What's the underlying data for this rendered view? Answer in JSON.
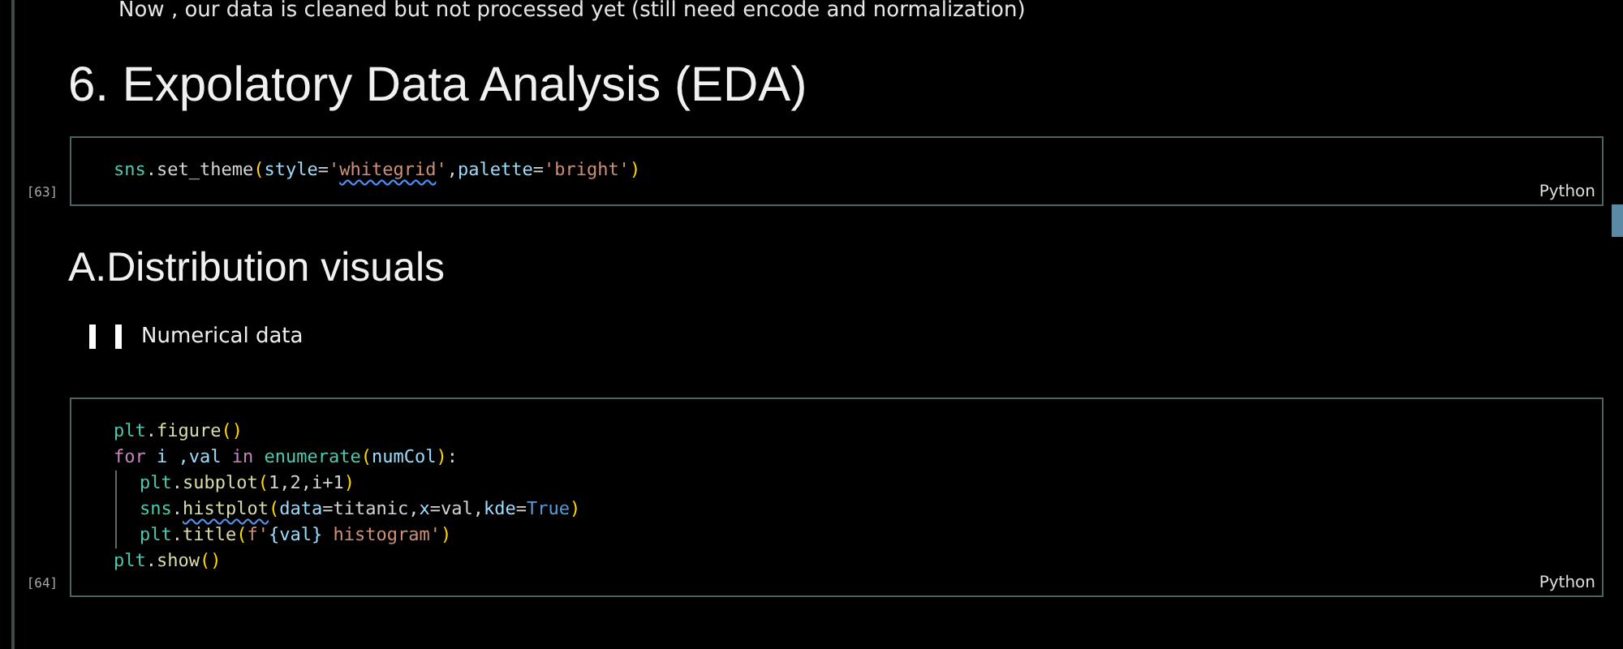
{
  "intro_text": "Now , our data is cleaned but not processed yet (still need encode and normalization)",
  "heading": "6. Expolatory Data Analysis (EDA)",
  "cells": [
    {
      "execution_count": "[63]",
      "language": "Python",
      "lines": [
        {
          "tokens": [
            {
              "t": "sns",
              "kind": "module"
            },
            {
              "t": ".set_theme",
              "kind": "plain"
            },
            {
              "t": "(",
              "kind": "paren"
            },
            {
              "t": "style",
              "kind": "var"
            },
            {
              "t": "=",
              "kind": "plain"
            },
            {
              "t": "'",
              "kind": "str"
            },
            {
              "t": "whitegrid",
              "kind": "str",
              "squiggle": true
            },
            {
              "t": "'",
              "kind": "str"
            },
            {
              "t": ",",
              "kind": "plain"
            },
            {
              "t": "palette",
              "kind": "var"
            },
            {
              "t": "=",
              "kind": "plain"
            },
            {
              "t": "'bright'",
              "kind": "str"
            },
            {
              "t": ")",
              "kind": "paren"
            }
          ]
        }
      ]
    }
  ],
  "subheading": "A.Distribution visuals",
  "quote_text": "Numerical data",
  "cells2": [
    {
      "execution_count": "[64]",
      "language": "Python",
      "lines": [
        {
          "tokens": [
            {
              "t": "plt",
              "kind": "module"
            },
            {
              "t": ".",
              "kind": "plain"
            },
            {
              "t": "figure",
              "kind": "func"
            },
            {
              "t": "()",
              "kind": "paren"
            }
          ]
        },
        {
          "tokens": [
            {
              "t": "for",
              "kind": "kw"
            },
            {
              "t": " i ,",
              "kind": "var"
            },
            {
              "t": "val",
              "kind": "var"
            },
            {
              "t": " in ",
              "kind": "kw"
            },
            {
              "t": "enumerate",
              "kind": "module"
            },
            {
              "t": "(",
              "kind": "paren"
            },
            {
              "t": "numCol",
              "kind": "var"
            },
            {
              "t": ")",
              "kind": "paren"
            },
            {
              "t": ":",
              "kind": "plain"
            }
          ],
          "children": [
            {
              "tokens": [
                {
                  "t": "plt",
                  "kind": "module"
                },
                {
                  "t": ".",
                  "kind": "plain"
                },
                {
                  "t": "subplot",
                  "kind": "func"
                },
                {
                  "t": "(",
                  "kind": "paren"
                },
                {
                  "t": "1,2,i+1",
                  "kind": "plain"
                },
                {
                  "t": ")",
                  "kind": "paren"
                }
              ]
            },
            {
              "tokens": [
                {
                  "t": "sns",
                  "kind": "module"
                },
                {
                  "t": ".",
                  "kind": "plain"
                },
                {
                  "t": "histplot",
                  "kind": "func",
                  "squiggle": true
                },
                {
                  "t": "(",
                  "kind": "paren"
                },
                {
                  "t": "data",
                  "kind": "var"
                },
                {
                  "t": "=titanic,",
                  "kind": "plain"
                },
                {
                  "t": "x",
                  "kind": "var"
                },
                {
                  "t": "=val,",
                  "kind": "plain"
                },
                {
                  "t": "kde",
                  "kind": "var"
                },
                {
                  "t": "=",
                  "kind": "plain"
                },
                {
                  "t": "True",
                  "kind": "const"
                },
                {
                  "t": ")",
                  "kind": "paren"
                }
              ]
            },
            {
              "tokens": [
                {
                  "t": "plt",
                  "kind": "module"
                },
                {
                  "t": ".",
                  "kind": "plain"
                },
                {
                  "t": "title",
                  "kind": "func"
                },
                {
                  "t": "(",
                  "kind": "paren"
                },
                {
                  "t": "f'",
                  "kind": "str"
                },
                {
                  "t": "{val}",
                  "kind": "var"
                },
                {
                  "t": " histogram'",
                  "kind": "str"
                },
                {
                  "t": ")",
                  "kind": "paren"
                }
              ]
            }
          ]
        },
        {
          "tokens": [
            {
              "t": "plt",
              "kind": "module"
            },
            {
              "t": ".",
              "kind": "plain"
            },
            {
              "t": "show",
              "kind": "func"
            },
            {
              "t": "()",
              "kind": "paren"
            }
          ]
        }
      ]
    }
  ]
}
